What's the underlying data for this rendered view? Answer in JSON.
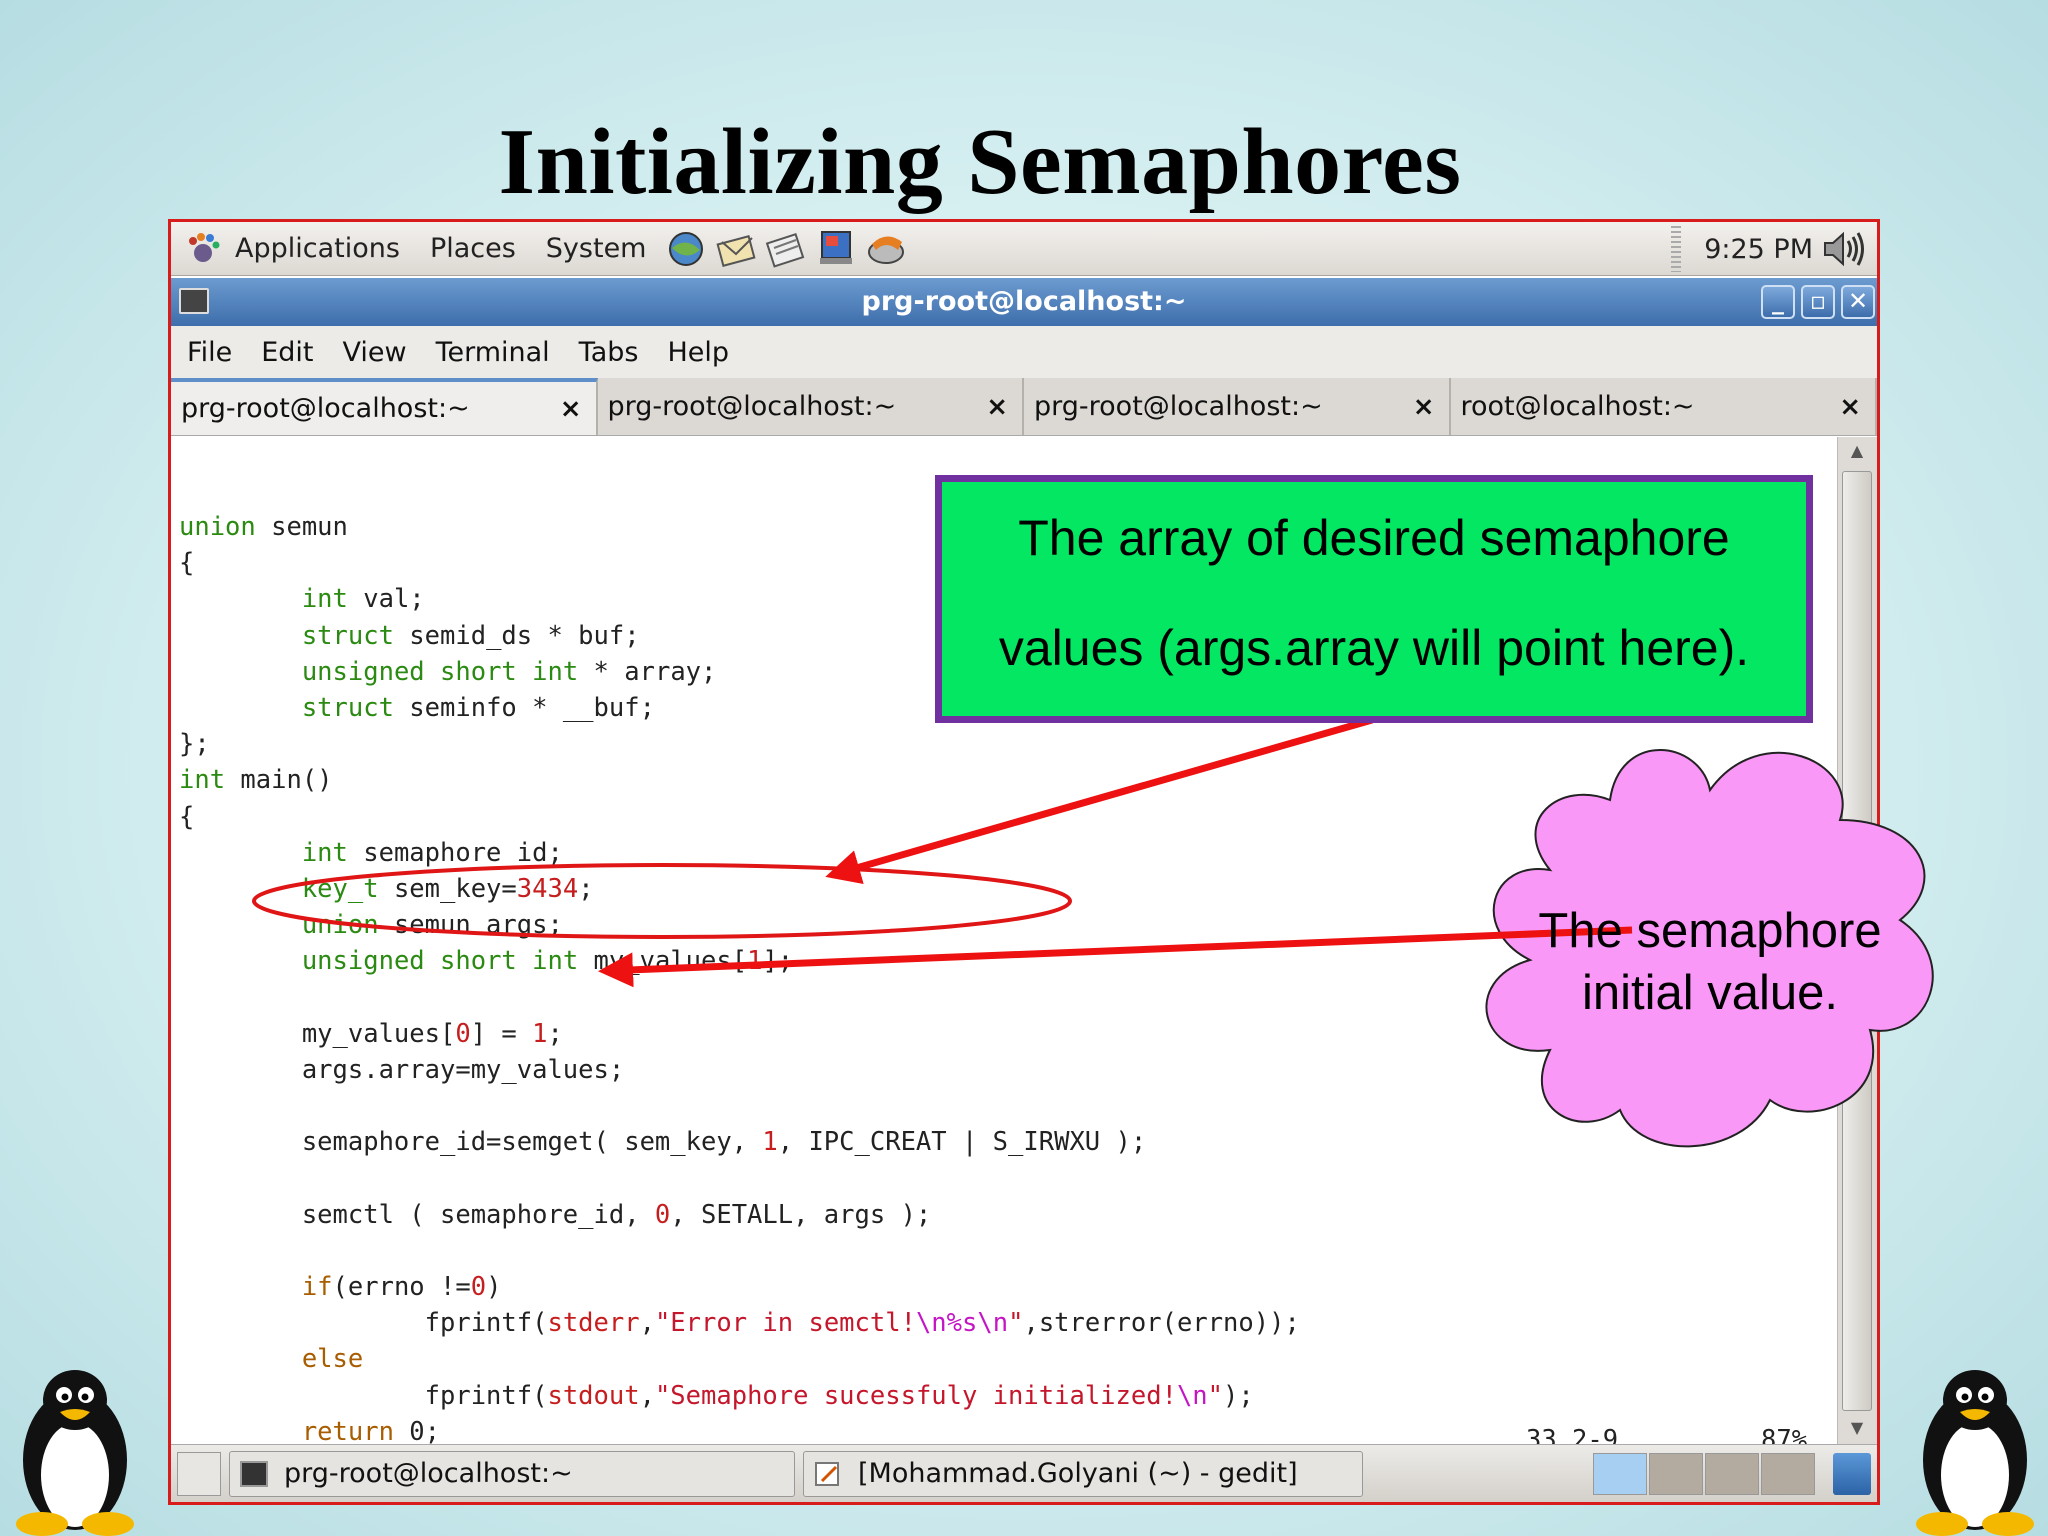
{
  "slide": {
    "title": "Initializing Semaphores"
  },
  "top_panel": {
    "menus": [
      "Applications",
      "Places",
      "System"
    ],
    "clock": "9:25 PM",
    "launcher_icons": [
      "browser-icon",
      "mail-icon",
      "notes-icon",
      "presentation-icon",
      "disk-icon"
    ]
  },
  "window": {
    "title": "prg-root@localhost:~",
    "controls": [
      "minimize",
      "maximize",
      "close"
    ]
  },
  "menubar": {
    "items": [
      "File",
      "Edit",
      "View",
      "Terminal",
      "Tabs",
      "Help"
    ]
  },
  "tabs": [
    {
      "label": "prg-root@localhost:~",
      "close": "×",
      "active": true
    },
    {
      "label": "prg-root@localhost:~",
      "close": "×",
      "active": false
    },
    {
      "label": "prg-root@localhost:~",
      "close": "×",
      "active": false
    },
    {
      "label": "root@localhost:~",
      "close": "×",
      "active": false
    }
  ],
  "code": [
    "union semun",
    "{",
    "        int val;",
    "        struct semid_ds * buf;",
    "        unsigned short int * array;",
    "        struct seminfo * __buf;",
    "};",
    "int main()",
    "{",
    "        int semaphore_id;",
    "        key_t sem_key=3434;",
    "        union semun args;",
    "        unsigned short int my_values[1];",
    "",
    "        my_values[0] = 1;",
    "        args.array=my_values;",
    "",
    "        semaphore_id=semget( sem_key, 1, IPC_CREAT | S_IRWXU );",
    "",
    "        semctl ( semaphore_id, 0, SETALL, args );",
    "",
    "        if(errno !=0)",
    "                fprintf(stderr,\"Error in semctl!\\n%s\\n\",strerror(errno));",
    "        else",
    "                fprintf(stdout,\"Semaphore sucessfuly initialized!\\n\");",
    "        return 0;"
  ],
  "status": {
    "position": "33,2-9",
    "percent": "87%"
  },
  "taskbar": {
    "tasks": [
      {
        "label": "prg-root@localhost:~",
        "icon": "terminal-icon"
      },
      {
        "label": "[Mohammad.Golyani (~) - gedit]",
        "icon": "gedit-icon"
      }
    ],
    "workspace_count": 4,
    "active_workspace": 1
  },
  "annotations": {
    "box": {
      "line1": "The array of desired semaphore",
      "line2": "values (args.array will point here)."
    },
    "cloud": {
      "line1": "The semaphore",
      "line2": "initial value."
    },
    "colors": {
      "box_fill": "#03e763",
      "box_border": "#7030a0",
      "cloud_fill": "#fa98f7",
      "arrow": "#ee1111"
    }
  }
}
